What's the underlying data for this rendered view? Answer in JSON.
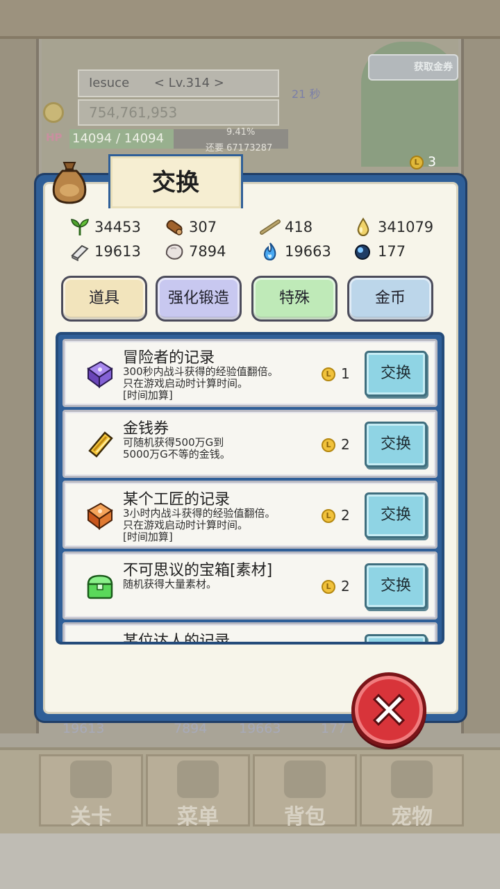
{
  "hud": {
    "player_name": "Iesuce",
    "level": "< Lv.314 >",
    "gold": "754,761,953",
    "hp_label": "HP",
    "hp": "14094 / 14094",
    "exp_percent": "9.41%",
    "exp_remaining": "还要 67173287",
    "timer": "21 秒",
    "ad_button_label": "获取金券",
    "ticket_count": "3"
  },
  "modal": {
    "title": "交换",
    "resources": [
      {
        "icon": "herb-icon",
        "value": "34453"
      },
      {
        "icon": "wood-log-icon",
        "value": "307"
      },
      {
        "icon": "branch-icon",
        "value": "418"
      },
      {
        "icon": "oil-drop-icon",
        "value": "341079"
      },
      {
        "icon": "iron-ingot-icon",
        "value": "19613"
      },
      {
        "icon": "stone-icon",
        "value": "7894"
      },
      {
        "icon": "blue-flame-icon",
        "value": "19663"
      },
      {
        "icon": "dark-orb-icon",
        "value": "177"
      }
    ],
    "categories": [
      {
        "label": "道具",
        "color": "#f2e4bc"
      },
      {
        "label": "强化锻造",
        "color": "#c8c8f0"
      },
      {
        "label": "特殊",
        "color": "#bfeab8"
      },
      {
        "label": "金币",
        "color": "#bcd6ea"
      }
    ],
    "items": [
      {
        "title": "冒险者的记录",
        "desc": [
          "300秒内战斗获得的经验值翻倍。",
          "只在游戏启动时计算时间。",
          "[时间加算]"
        ],
        "cost": "1",
        "button": "交换",
        "icon_color": "#7b55c8"
      },
      {
        "title": "金钱券",
        "desc": [
          "可随机获得500万G到",
          "5000万G不等的金钱。"
        ],
        "cost": "2",
        "button": "交换",
        "icon_color": "#e6a919"
      },
      {
        "title": "某个工匠的记录",
        "desc": [
          "3小时内战斗获得的经验值翻倍。",
          "只在游戏启动时计算时间。",
          "[时间加算]"
        ],
        "cost": "2",
        "button": "交换",
        "icon_color": "#e0722a"
      },
      {
        "title": "不可思议的宝箱[素材]",
        "desc": [
          "随机获得大量素材。"
        ],
        "cost": "2",
        "button": "交换",
        "icon_color": "#5cd65a"
      },
      {
        "title": "某位达人的记录",
        "desc": [],
        "cost": "",
        "button": "",
        "icon_color": "#8a8a8a"
      }
    ],
    "cost_icon_letter": "L"
  },
  "bottom_resources": [
    "19613",
    "7894",
    "19663",
    "177"
  ],
  "nav": [
    {
      "label": "关卡",
      "icon": "crossed-swords-icon"
    },
    {
      "label": "菜单",
      "icon": "book-icon"
    },
    {
      "label": "背包",
      "icon": "backpack-icon"
    },
    {
      "label": "宠物",
      "icon": "dragon-icon"
    }
  ]
}
